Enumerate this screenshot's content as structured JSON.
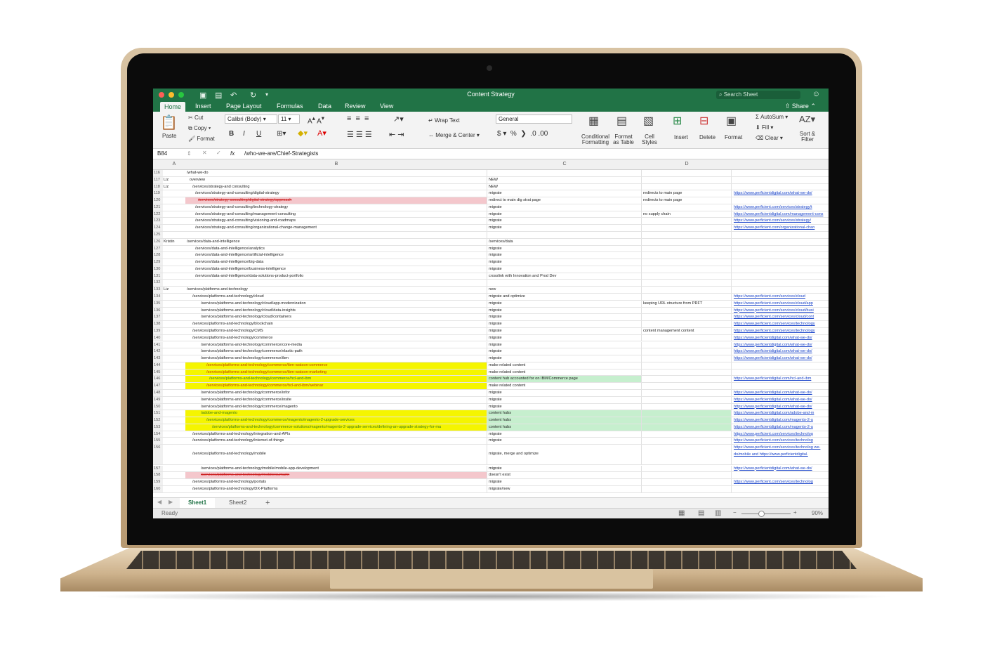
{
  "app": {
    "window_title": "Content Strategy",
    "search_placeholder": "Search Sheet",
    "share_label": "Share",
    "tabs": [
      "Home",
      "Insert",
      "Page Layout",
      "Formulas",
      "Data",
      "Review",
      "View"
    ]
  },
  "ribbon": {
    "paste": "Paste",
    "cut": "Cut",
    "copy": "Copy",
    "format": "Format",
    "font_name": "Calibri (Body)",
    "font_size": "11",
    "wrap_text": "Wrap Text",
    "merge_center": "Merge & Center",
    "number_format": "General",
    "conditional_formatting": "Conditional Formatting",
    "format_as_table": "Format as Table",
    "cell_styles": "Cell Styles",
    "insert": "Insert",
    "delete": "Delete",
    "format_cells": "Format",
    "autosum": "AutoSum",
    "fill": "Fill",
    "clear": "Clear",
    "sort_filter": "Sort & Filter"
  },
  "formula_bar": {
    "cell_ref": "B84",
    "fx": "fx",
    "content": "/who-we-are/Chief-Strategists"
  },
  "columns": [
    "A",
    "B",
    "C",
    "D"
  ],
  "rows": [
    {
      "n": "116",
      "a": "",
      "b": "/what-we-do",
      "c": "",
      "d": "",
      "e": "",
      "fill": "",
      "indent": 0
    },
    {
      "n": "117",
      "a": "Liz",
      "b": "overview",
      "c": "NEW",
      "d": "",
      "e": "",
      "fill": "",
      "indent": 1
    },
    {
      "n": "118",
      "a": "Liz",
      "b": "/services/strategy-and consulting",
      "c": "NEW",
      "d": "",
      "e": "",
      "fill": "",
      "indent": 2
    },
    {
      "n": "119",
      "a": "",
      "b": "/services/strategy-and-consulting/digital-strategy",
      "c": "migrate",
      "d": "redirects to main page",
      "e": "https://www.perficientdigital.com/what-we-do/",
      "fill": "",
      "indent": 3
    },
    {
      "n": "120",
      "a": "",
      "b": "/services/strategy-consulting/digital-strategy/approach",
      "c": "redirect to main dig strat page",
      "d": "redirects to main page",
      "e": "",
      "fill": "pink",
      "indent": 4,
      "strike": true
    },
    {
      "n": "121",
      "a": "",
      "b": "/services/strategy-and-consulting/technology-strategy",
      "c": "migrate",
      "d": "",
      "e": "https://www.perficient.com/services/strategy/t",
      "fill": "",
      "indent": 3
    },
    {
      "n": "122",
      "a": "",
      "b": "/services/strategy-and-consulting/management-consulting",
      "c": "migrate",
      "d": "no supply chain",
      "e": "https://www.perficientdigital.com/management-cons",
      "fill": "",
      "indent": 3
    },
    {
      "n": "123",
      "a": "",
      "b": "/services/strategy-and-consulting/visioning-and-roadmaps",
      "c": "migrate",
      "d": "",
      "e": "https://www.perficient.com/services/strategy/",
      "fill": "",
      "indent": 3
    },
    {
      "n": "124",
      "a": "",
      "b": "/services/strategy-and-consulting/organizational-change-management",
      "c": "migrate",
      "d": "",
      "e": "https://www.perficient.com/organizational-chan",
      "fill": "",
      "indent": 3
    },
    {
      "n": "125",
      "a": "",
      "b": "",
      "c": "",
      "d": "",
      "e": "",
      "fill": "",
      "indent": 0
    },
    {
      "n": "126",
      "a": "Kristin",
      "b": "/services/data-and-intelligence",
      "c": "/services/data",
      "d": "",
      "e": "",
      "fill": "",
      "indent": 0
    },
    {
      "n": "127",
      "a": "",
      "b": "/services/data-and-intelligence/analytics",
      "c": "migrate",
      "d": "",
      "e": "",
      "fill": "",
      "indent": 3
    },
    {
      "n": "128",
      "a": "",
      "b": "/services/data-and-intelligence/artificial-intelligence",
      "c": "migrate",
      "d": "",
      "e": "",
      "fill": "",
      "indent": 3
    },
    {
      "n": "129",
      "a": "",
      "b": "/services/data-and-intelligence/big-data",
      "c": "migrate",
      "d": "",
      "e": "",
      "fill": "",
      "indent": 3
    },
    {
      "n": "130",
      "a": "",
      "b": "/services/data-and-intelligence/business-intelligence",
      "c": "migrate",
      "d": "",
      "e": "",
      "fill": "",
      "indent": 3
    },
    {
      "n": "131",
      "a": "",
      "b": "/services/data-and-intelligence/data-solutions-product-portfolio",
      "c": "crosslink with Innovation and Prod Dev",
      "d": "",
      "e": "",
      "fill": "",
      "indent": 3
    },
    {
      "n": "132",
      "a": "",
      "b": "",
      "c": "",
      "d": "",
      "e": "",
      "fill": "",
      "indent": 0
    },
    {
      "n": "133",
      "a": "Liz",
      "b": "/services/platforms-and-technology",
      "c": "new",
      "d": "",
      "e": "",
      "fill": "",
      "indent": 0
    },
    {
      "n": "134",
      "a": "",
      "b": "/services/platforms-and-technology/cloud",
      "c": "migrate and optimize",
      "d": "",
      "e": "https://www.perficient.com/services/cloud",
      "fill": "",
      "indent": 2
    },
    {
      "n": "135",
      "a": "",
      "b": "/services/platforms-and-technology/cloud/app-modernization",
      "c": "migrate",
      "d": "keeping URL structure from PRFT",
      "e": "https://www.perficient.com/services/cloud/app",
      "fill": "",
      "indent": 5
    },
    {
      "n": "136",
      "a": "",
      "b": "/services/platforms-and-technology/cloud/data-insights",
      "c": "migrate",
      "d": "",
      "e": "https://www.perficient.com/services/cloud/busi",
      "fill": "",
      "indent": 5
    },
    {
      "n": "137",
      "a": "",
      "b": "/services/platforms-and-technology/cloud/containers",
      "c": "migrate",
      "d": "",
      "e": "https://www.perficient.com/services/cloud/cont",
      "fill": "",
      "indent": 5
    },
    {
      "n": "138",
      "a": "",
      "b": "/services/platforms-and-technology/blockchain",
      "c": "migrate",
      "d": "",
      "e": "https://www.perficient.com/services/technology",
      "fill": "",
      "indent": 2
    },
    {
      "n": "139",
      "a": "",
      "b": "/services/platforms-and-technology/CMS",
      "c": "migrate",
      "d": "content management content",
      "e": "https://www.perficient.com/services/technology",
      "fill": "",
      "indent": 2
    },
    {
      "n": "140",
      "a": "",
      "b": "/services/platforms-and-technology/commerce",
      "c": "migrate",
      "d": "",
      "e": "https://www.perficientdigital.com/what-we-do/",
      "fill": "",
      "indent": 2
    },
    {
      "n": "141",
      "a": "",
      "b": "/services/platforms-and-technology/commerce/core-media",
      "c": "migrate",
      "d": "",
      "e": "https://www.perficientdigital.com/what-we-do/",
      "fill": "",
      "indent": 5
    },
    {
      "n": "142",
      "a": "",
      "b": "/services/platforms-and-technology/commerce/elastic-path",
      "c": "migrate",
      "d": "",
      "e": "https://www.perficientdigital.com/what-we-do/",
      "fill": "",
      "indent": 5
    },
    {
      "n": "143",
      "a": "",
      "b": "/services/platforms-and-technology/commerce/ibm",
      "c": "migrate",
      "d": "",
      "e": "https://www.perficientdigital.com/what-we-do/",
      "fill": "",
      "indent": 5
    },
    {
      "n": "144",
      "a": "",
      "b": "/services/platforms-and-technology/commerce/ibm-watson-commerce",
      "c": "make related content",
      "d": "",
      "e": "",
      "fill": "yellow",
      "indent": 7,
      "red": true
    },
    {
      "n": "145",
      "a": "",
      "b": "/services/platforms-and-technology/commerce/ibm-watson-marketing",
      "c": "make related content",
      "d": "",
      "e": "",
      "fill": "yellow",
      "indent": 7,
      "red": true
    },
    {
      "n": "146",
      "a": "",
      "b": "/services/platforms-and-technology/commerce/hcl-and-ibm",
      "c": "content hub accounted for on IBM/Commerce page",
      "d": "",
      "e": "https://www.perficientdigital.com/hcl-and-ibm",
      "fill": "yellow",
      "indent": 8,
      "green_c": true
    },
    {
      "n": "147",
      "a": "",
      "b": "/services/platforms-and-technology/commerce/hcl-and-ibm/webinar",
      "c": "make related content",
      "d": "",
      "e": "",
      "fill": "yellow",
      "indent": 7,
      "red": true
    },
    {
      "n": "148",
      "a": "",
      "b": "/services/platforms-and-technology/commerce/infor",
      "c": "migrate",
      "d": "",
      "e": "https://www.perficientdigital.com/what-we-do/",
      "fill": "",
      "indent": 5
    },
    {
      "n": "149",
      "a": "",
      "b": "/services/platforms-and-technology/commerce/insite",
      "c": "migrate",
      "d": "",
      "e": "https://www.perficientdigital.com/what-we-do/",
      "fill": "",
      "indent": 5
    },
    {
      "n": "150",
      "a": "",
      "b": "/services/platforms-and-technology/commerce/magento",
      "c": "migrate",
      "d": "",
      "e": "https://www.perficientdigital.com/what-we-do/",
      "fill": "",
      "indent": 5
    },
    {
      "n": "151",
      "a": "",
      "b": "/adobe-and-magento",
      "c": "content hubs",
      "d": "",
      "e": "https://www.perficientdigital.com/adobe-and-m",
      "fill": "yellow",
      "indent": 5,
      "green_cd": true
    },
    {
      "n": "152",
      "a": "",
      "b": "/services/platforms-and-technology/commerce/magento/magento-2-upgrade-services",
      "c": "content hubs",
      "d": "",
      "e": "https://www.perficientdigital.com/magento-2-u",
      "fill": "yellow",
      "indent": 7,
      "green_cd": true
    },
    {
      "n": "153",
      "a": "",
      "b": "/services/platforms-and-technology/commerce-solutions/magento/magento-2-upgrade-services/defining-an-upgrade-strategy-for-ma",
      "c": "content hubs",
      "d": "",
      "e": "https://www.perficientdigital.com/magento-2-u",
      "fill": "yellow",
      "indent": 9,
      "green_cd": true
    },
    {
      "n": "154",
      "a": "",
      "b": "/services/platforms-and-technology/integration-and-APIs",
      "c": "migrate",
      "d": "",
      "e": "https://www.perficient.com/services/technolog",
      "fill": "",
      "indent": 2
    },
    {
      "n": "155",
      "a": "",
      "b": "/services/platforms-and-technology/internet-of-things",
      "c": "migrate",
      "d": "",
      "e": "https://www.perficient.com/services/technolog",
      "fill": "",
      "indent": 2
    },
    {
      "n": "156",
      "a": "",
      "b": "/services/platforms-and-technology/mobile",
      "c": "migrate, merge and optimize",
      "d": "",
      "e": "https://www.perficient.com/services/technolog we-do/mobile and https://www.perficientdigital.",
      "fill": "",
      "indent": 2,
      "tall": true
    },
    {
      "n": "157",
      "a": "",
      "b": "/services/platforms-and-technology/mobile/mobile-app-development",
      "c": "migrate",
      "d": "",
      "e": "https://www.perficientdigital.com/what-we-do/",
      "fill": "",
      "indent": 5
    },
    {
      "n": "158",
      "a": "",
      "b": "/services/platforms-and-technology/mobile/sumarin",
      "c": "doesn't exist",
      "d": "",
      "e": "",
      "fill": "pink",
      "indent": 5,
      "strike": true
    },
    {
      "n": "159",
      "a": "",
      "b": "/services/platforms-and-technology/portals",
      "c": "migrate",
      "d": "",
      "e": "https://www.perficient.com/services/technolog",
      "fill": "",
      "indent": 2
    },
    {
      "n": "160",
      "a": "",
      "b": "/services/platforms-and-technology/DX-Platforms",
      "c": "migrate/new",
      "d": "",
      "e": "",
      "fill": "",
      "indent": 2
    }
  ],
  "sheets": [
    "Sheet1",
    "Sheet2"
  ],
  "add_sheet": "+",
  "status": {
    "ready": "Ready",
    "zoom": "90%"
  },
  "colors": {
    "excel_green": "#217346",
    "yellow_fill": "#f5f500",
    "pink_fill": "#f4c7cc",
    "green_fill": "#c6efce",
    "link_blue": "#1a44c9"
  }
}
